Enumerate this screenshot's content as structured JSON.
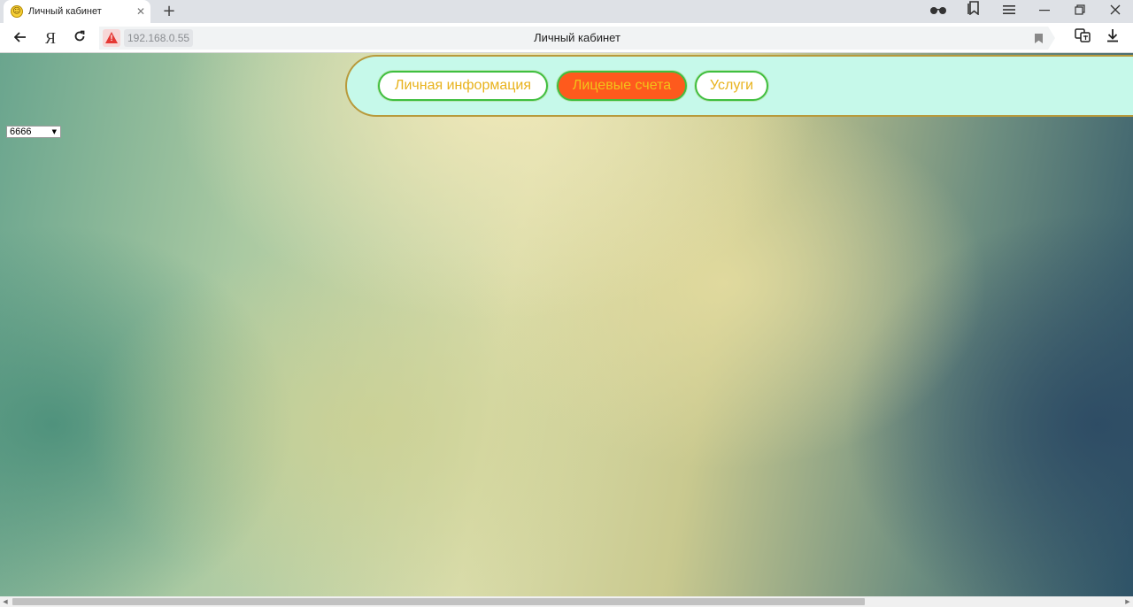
{
  "browser": {
    "tab_title": "Личный кабинет",
    "tab_close": "✕",
    "new_tab": "+",
    "address_ip": "192.168.0.55",
    "page_title": "Личный кабинет",
    "yandex_button": "Я",
    "icons": [
      "back-arrow-icon",
      "yandex-icon",
      "reload-icon",
      "warning-icon",
      "bookmark-icon",
      "glasses-icon",
      "collections-icon",
      "menu-icon",
      "minimize-icon",
      "restore-icon",
      "close-icon",
      "translate-icon",
      "download-icon"
    ]
  },
  "nav": {
    "personal_info": "Личная информация",
    "accounts": "Лицевые счета",
    "services": "Услуги",
    "active": "accounts"
  },
  "account_select": {
    "value": "6666"
  },
  "colors": {
    "nav_panel_bg": "#c6f9ea",
    "nav_panel_border": "#b89a3c",
    "button_border": "#3fbf3f",
    "button_text": "#e8b21c",
    "active_button_bg": "#fe5a1d"
  }
}
